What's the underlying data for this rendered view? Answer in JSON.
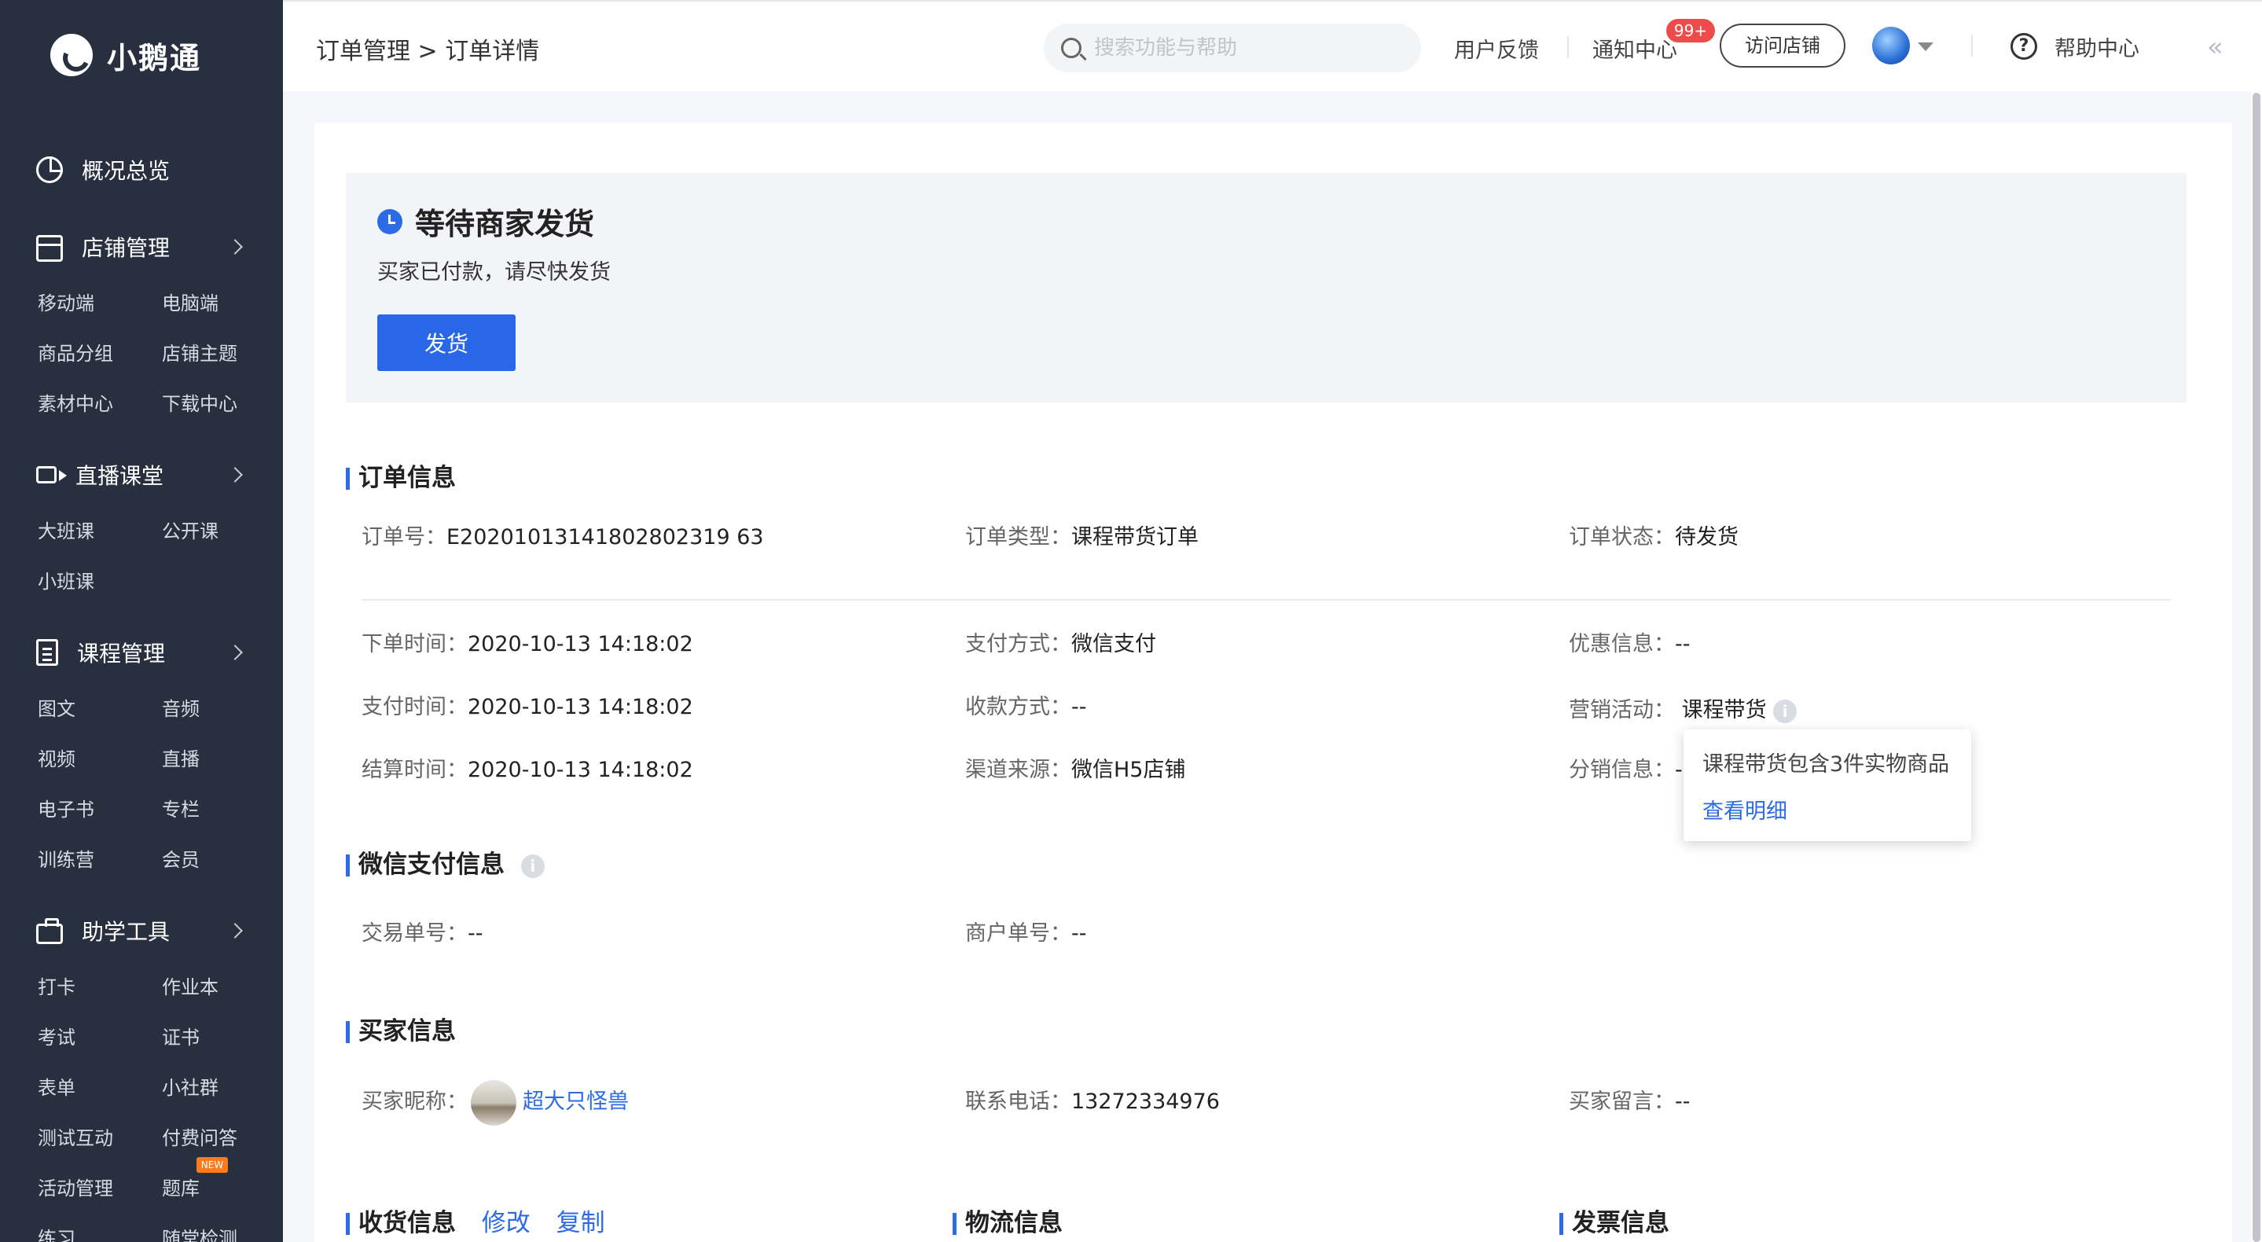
{
  "sidebar": {
    "brand": "小鹅通",
    "overview": "概况总览",
    "groups": [
      {
        "label": "店铺管理",
        "items": [
          "移动端",
          "电脑端",
          "商品分组",
          "店铺主题",
          "素材中心",
          "下载中心"
        ]
      },
      {
        "label": "直播课堂",
        "items": [
          "大班课",
          "公开课",
          "小班课"
        ]
      },
      {
        "label": "课程管理",
        "items": [
          "图文",
          "音频",
          "视频",
          "直播",
          "电子书",
          "专栏",
          "训练营",
          "会员"
        ]
      },
      {
        "label": "助学工具",
        "items": [
          "打卡",
          "作业本",
          "考试",
          "证书",
          "表单",
          "小社群",
          "测试互动",
          "付费问答",
          "活动管理",
          "题库",
          "练习",
          "随堂检测"
        ]
      }
    ],
    "new_badge": "NEW"
  },
  "topbar": {
    "breadcrumb": "订单管理 > 订单详情",
    "search_placeholder": "搜索功能与帮助",
    "feedback": "用户反馈",
    "notifications": "通知中心",
    "notif_count": "99+",
    "visit_store": "访问店铺",
    "help_center": "帮助中心",
    "collapse": "«"
  },
  "status": {
    "title": "等待商家发货",
    "desc": "买家已付款，请尽快发货",
    "ship_button": "发货"
  },
  "order_info": {
    "title": "订单信息",
    "order_no_label": "订单号：",
    "order_no": "E20201013141802802319 63",
    "order_type_label": "订单类型：",
    "order_type": "课程带货订单",
    "order_status_label": "订单状态：",
    "order_status": "待发货",
    "created_label": "下单时间：",
    "created": "2020-10-13 14:18:02",
    "pay_method_label": "支付方式：",
    "pay_method": "微信支付",
    "discount_label": "优惠信息：",
    "discount": "--",
    "paid_label": "支付时间：",
    "paid": "2020-10-13 14:18:02",
    "collect_label": "收款方式：",
    "collect": "--",
    "marketing_label": "营销活动：",
    "marketing": "课程带货",
    "settle_label": "结算时间：",
    "settle": "2020-10-13 14:18:02",
    "channel_label": "渠道来源：",
    "channel": "微信H5店铺",
    "distribution_label": "分销信息：",
    "distribution": "-"
  },
  "popover": {
    "text": "课程带货包含3件实物商品",
    "link": "查看明细"
  },
  "wechat_pay": {
    "title": "微信支付信息",
    "trade_no_label": "交易单号：",
    "trade_no": "--",
    "merchant_no_label": "商户单号：",
    "merchant_no": "--"
  },
  "buyer": {
    "title": "买家信息",
    "nickname_label": "买家昵称：",
    "nickname": "超大只怪兽",
    "phone_label": "联系电话：",
    "phone": "13272334976",
    "message_label": "买家留言：",
    "message": "--"
  },
  "bottom": {
    "shipping_title": "收货信息",
    "edit": "修改",
    "copy": "复制",
    "logistics_title": "物流信息",
    "invoice_title": "发票信息"
  },
  "colors": {
    "sidebar_bg": "#28303f",
    "accent": "#2d6be6",
    "badge": "#f04b4b"
  }
}
